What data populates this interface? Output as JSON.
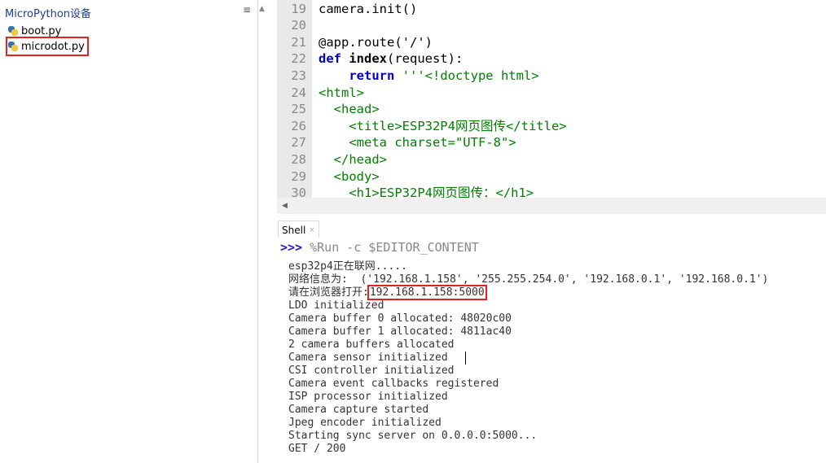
{
  "files": {
    "title": "MicroPython设备",
    "menu_glyph": "≡",
    "items": [
      {
        "name": "boot.py",
        "icon": "python-file-icon"
      },
      {
        "name": "microdot.py",
        "icon": "python-file-icon"
      }
    ]
  },
  "editor": {
    "scroll_up_glyph": "▲",
    "scroll_left_glyph": "◀",
    "lines": [
      {
        "n": "19",
        "code": "camera.init()"
      },
      {
        "n": "20",
        "code": ""
      },
      {
        "n": "21",
        "code": "@app.route('/')"
      },
      {
        "n": "22",
        "kw": "def ",
        "fn": "index",
        "code": "(request):"
      },
      {
        "n": "23",
        "kw": "    return ",
        "str": "'''<!doctype html>"
      },
      {
        "n": "24",
        "tag": "<html>"
      },
      {
        "n": "25",
        "tag": "  <head>"
      },
      {
        "n": "26",
        "tag": "    <title>ESP32P4网页图传</title>"
      },
      {
        "n": "27",
        "tag": "    <meta charset=\"UTF-8\">"
      },
      {
        "n": "28",
        "tag": "  </head>"
      },
      {
        "n": "29",
        "tag": "  <body>"
      },
      {
        "n": "30",
        "tag": "    <h1>ESP32P4网页图传：</h1>"
      }
    ]
  },
  "shell": {
    "tab_label": "Shell",
    "tab_close": "×",
    "prompt_symbol": ">>> ",
    "prompt_command": "%Run -c $EDITOR_CONTENT",
    "output": [
      "esp32p4正在联网.....",
      "网络信息为:  ('192.168.1.158', '255.255.254.0', '192.168.0.1', '192.168.0.1')",
      "请在浏览器打开:",
      "LDO initialized",
      "Camera buffer 0 allocated: 48020c00",
      "Camera buffer 1 allocated: 4811ac40",
      "2 camera buffers allocated",
      "Camera sensor initialized",
      "CSI controller initialized",
      "Camera event callbacks registered",
      "ISP processor initialized",
      "Camera capture started",
      "Jpeg encoder initialized",
      "Starting sync server on 0.0.0.0:5000...",
      "GET / 200"
    ],
    "highlight_ip": "192.168.1.158:5000"
  }
}
